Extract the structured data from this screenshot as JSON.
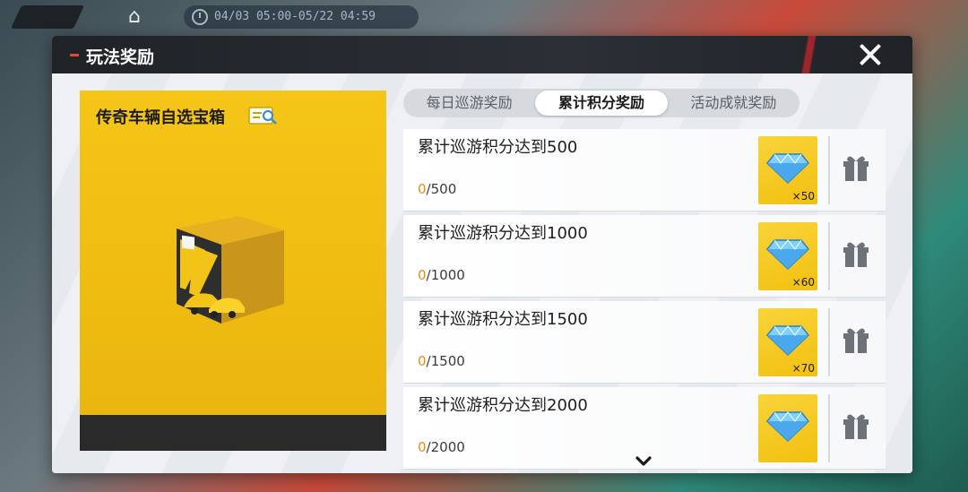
{
  "hud": {
    "timer_text": "04/03 05:00-05/22 04:59"
  },
  "dialog": {
    "title": "玩法奖励"
  },
  "reward_card": {
    "title": "传奇车辆自选宝箱"
  },
  "tabs": [
    {
      "label": "每日巡游奖励",
      "active": false
    },
    {
      "label": "累计积分奖励",
      "active": true
    },
    {
      "label": "活动成就奖励",
      "active": false
    }
  ],
  "tasks": [
    {
      "name": "累计巡游积分达到500",
      "current": "0",
      "target": "/500",
      "reward_qty": "×50"
    },
    {
      "name": "累计巡游积分达到1000",
      "current": "0",
      "target": "/1000",
      "reward_qty": "×60"
    },
    {
      "name": "累计巡游积分达到1500",
      "current": "0",
      "target": "/1500",
      "reward_qty": "×70"
    },
    {
      "name": "累计巡游积分达到2000",
      "current": "0",
      "target": "/2000",
      "reward_qty": ""
    }
  ],
  "icons": {
    "close": "close-icon",
    "gift": "gift-icon",
    "gem": "diamond-icon",
    "magnify": "magnify-icon",
    "scroll": "chevron-down-icon"
  },
  "colors": {
    "accent_yellow": "#f2c00f",
    "progress_orange": "#f08a1c",
    "header_dark": "#1f2328",
    "header_red": "#b3262b"
  }
}
